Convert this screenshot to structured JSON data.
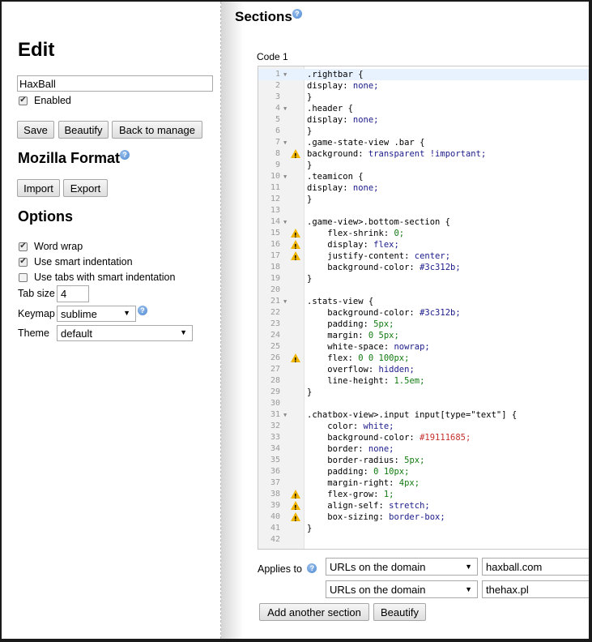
{
  "left": {
    "title": "Edit",
    "name_value": "HaxBall",
    "enabled_label": "Enabled",
    "buttons": {
      "save": "Save",
      "beautify": "Beautify",
      "back": "Back to manage"
    },
    "mozilla_title": "Mozilla Format",
    "import_label": "Import",
    "export_label": "Export",
    "options_title": "Options",
    "word_wrap": "Word wrap",
    "smart_indent": "Use smart indentation",
    "tabs_smart": "Use tabs with smart indentation",
    "tab_size_label": "Tab size",
    "tab_size_value": "4",
    "keymap_label": "Keymap",
    "keymap_value": "sublime",
    "theme_label": "Theme",
    "theme_value": "default",
    "help_glyph": "?"
  },
  "right": {
    "title": "Sections",
    "code_label": "Code 1",
    "applies_label": "Applies to",
    "applies": [
      {
        "type": "URLs on the domain",
        "value": "haxball.com"
      },
      {
        "type": "URLs on the domain",
        "value": "thehax.pl"
      }
    ],
    "add_section": "Add another section",
    "beautify": "Beautify"
  },
  "code_lines": [
    {
      "n": "1",
      "fold": true,
      "warn": false,
      "text": ".rightbar {"
    },
    {
      "n": "2",
      "fold": false,
      "warn": false,
      "text": "display: none;"
    },
    {
      "n": "3",
      "fold": false,
      "warn": false,
      "text": "}"
    },
    {
      "n": "4",
      "fold": true,
      "warn": false,
      "text": ".header {"
    },
    {
      "n": "5",
      "fold": false,
      "warn": false,
      "text": "display: none;"
    },
    {
      "n": "6",
      "fold": false,
      "warn": false,
      "text": "}"
    },
    {
      "n": "7",
      "fold": true,
      "warn": false,
      "text": ".game-state-view .bar {"
    },
    {
      "n": "8",
      "fold": false,
      "warn": true,
      "text": "background: transparent !important;"
    },
    {
      "n": "9",
      "fold": false,
      "warn": false,
      "text": "}"
    },
    {
      "n": "10",
      "fold": true,
      "warn": false,
      "text": ".teamicon {"
    },
    {
      "n": "11",
      "fold": false,
      "warn": false,
      "text": "display: none;"
    },
    {
      "n": "12",
      "fold": false,
      "warn": false,
      "text": "}"
    },
    {
      "n": "13",
      "fold": false,
      "warn": false,
      "text": ""
    },
    {
      "n": "14",
      "fold": true,
      "warn": false,
      "text": ".game-view>.bottom-section {"
    },
    {
      "n": "15",
      "fold": false,
      "warn": true,
      "text": "    flex-shrink: 0;"
    },
    {
      "n": "16",
      "fold": false,
      "warn": true,
      "text": "    display: flex;"
    },
    {
      "n": "17",
      "fold": false,
      "warn": true,
      "text": "    justify-content: center;"
    },
    {
      "n": "18",
      "fold": false,
      "warn": false,
      "text": "    background-color: #3c312b;"
    },
    {
      "n": "19",
      "fold": false,
      "warn": false,
      "text": "}"
    },
    {
      "n": "20",
      "fold": false,
      "warn": false,
      "text": ""
    },
    {
      "n": "21",
      "fold": true,
      "warn": false,
      "text": ".stats-view {"
    },
    {
      "n": "22",
      "fold": false,
      "warn": false,
      "text": "    background-color: #3c312b;"
    },
    {
      "n": "23",
      "fold": false,
      "warn": false,
      "text": "    padding: 5px;"
    },
    {
      "n": "24",
      "fold": false,
      "warn": false,
      "text": "    margin: 0 5px;"
    },
    {
      "n": "25",
      "fold": false,
      "warn": false,
      "text": "    white-space: nowrap;"
    },
    {
      "n": "26",
      "fold": false,
      "warn": true,
      "text": "    flex: 0 0 100px;"
    },
    {
      "n": "27",
      "fold": false,
      "warn": false,
      "text": "    overflow: hidden;"
    },
    {
      "n": "28",
      "fold": false,
      "warn": false,
      "text": "    line-height: 1.5em;"
    },
    {
      "n": "29",
      "fold": false,
      "warn": false,
      "text": "}"
    },
    {
      "n": "30",
      "fold": false,
      "warn": false,
      "text": ""
    },
    {
      "n": "31",
      "fold": true,
      "warn": false,
      "text": ".chatbox-view>.input input[type=\"text\"] {"
    },
    {
      "n": "32",
      "fold": false,
      "warn": false,
      "text": "    color: white;"
    },
    {
      "n": "33",
      "fold": false,
      "warn": false,
      "text": "    background-color: #19111685;"
    },
    {
      "n": "34",
      "fold": false,
      "warn": false,
      "text": "    border: none;"
    },
    {
      "n": "35",
      "fold": false,
      "warn": false,
      "text": "    border-radius: 5px;"
    },
    {
      "n": "36",
      "fold": false,
      "warn": false,
      "text": "    padding: 0 10px;"
    },
    {
      "n": "37",
      "fold": false,
      "warn": false,
      "text": "    margin-right: 4px;"
    },
    {
      "n": "38",
      "fold": false,
      "warn": true,
      "text": "    flex-grow: 1;"
    },
    {
      "n": "39",
      "fold": false,
      "warn": true,
      "text": "    align-self: stretch;"
    },
    {
      "n": "40",
      "fold": false,
      "warn": true,
      "text": "    box-sizing: border-box;"
    },
    {
      "n": "41",
      "fold": false,
      "warn": false,
      "text": "}"
    },
    {
      "n": "42",
      "fold": false,
      "warn": false,
      "text": ""
    }
  ]
}
